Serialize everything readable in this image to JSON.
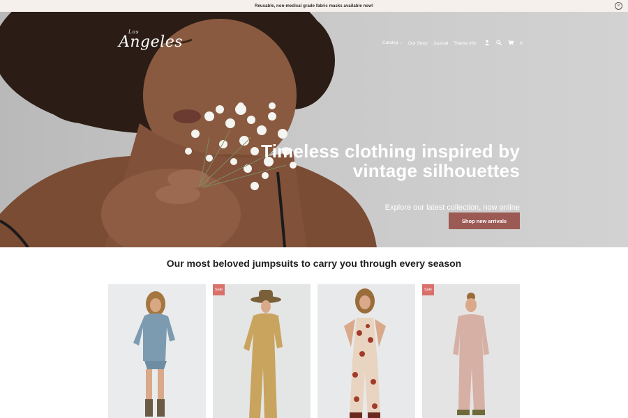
{
  "announcement": {
    "text": "Reusable, non-medical grade fabric masks available now!",
    "close_icon": "close-circle-icon"
  },
  "header": {
    "logo_small": "Los",
    "logo_big": "Angeles",
    "nav": [
      {
        "label": "Catalog",
        "has_dropdown": true
      },
      {
        "label": "Our Story"
      },
      {
        "label": "Journal"
      },
      {
        "label": "Theme info"
      }
    ],
    "icons": [
      "user-icon",
      "search-icon",
      "cart-icon"
    ],
    "cart_count": "0"
  },
  "hero": {
    "title_line1": "Timeless clothing inspired by",
    "title_line2": "vintage silhouettes",
    "subtitle": "Explore our latest collection, now online",
    "cta": "Shop new arrivals",
    "cta_color": "#9b5a54"
  },
  "section": {
    "title": "Our most beloved jumpsuits to carry you through every season"
  },
  "products": [
    {
      "sale": false,
      "badge": ""
    },
    {
      "sale": true,
      "badge": "Sale"
    },
    {
      "sale": false,
      "badge": ""
    },
    {
      "sale": true,
      "badge": "Sale"
    }
  ],
  "colors": {
    "announcement_bg": "#f6f0ec",
    "sale_badge": "#d9706a"
  }
}
